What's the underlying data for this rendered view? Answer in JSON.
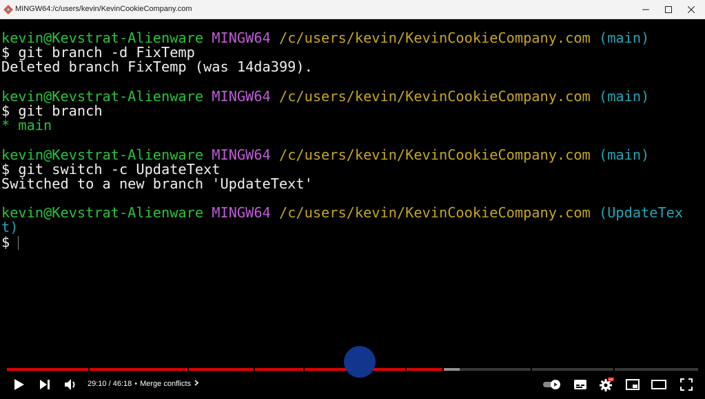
{
  "window": {
    "title": "MINGW64:/c/users/kevin/KevinCookieCompany.com"
  },
  "terminal": {
    "blocks": [
      {
        "user": "kevin@Kevstrat-Alienware",
        "env": "MINGW64",
        "path": "/c/users/kevin/KevinCookieCompany.com",
        "branch": "(main)",
        "command": "$ git branch -d FixTemp",
        "output": "Deleted branch FixTemp (was 14da399)."
      },
      {
        "user": "kevin@Kevstrat-Alienware",
        "env": "MINGW64",
        "path": "/c/users/kevin/KevinCookieCompany.com",
        "branch": "(main)",
        "command": "$ git branch",
        "output": "* main"
      },
      {
        "user": "kevin@Kevstrat-Alienware",
        "env": "MINGW64",
        "path": "/c/users/kevin/KevinCookieCompany.com",
        "branch": "(main)",
        "command": "$ git switch -c UpdateText",
        "output": "Switched to a new branch 'UpdateText'"
      },
      {
        "user": "kevin@Kevstrat-Alienware",
        "env": "MINGW64",
        "path": "/c/users/kevin/KevinCookieCompany.com",
        "branch_part1": "(UpdateTex",
        "branch_part2": "t)",
        "prompt": "$"
      }
    ]
  },
  "player": {
    "current_time": "29:10",
    "duration": "46:18",
    "separator": "•",
    "chapter": "Merge conflicts",
    "progress_fraction": 0.63,
    "buffer_fraction": 0.655,
    "hd_badge": "HD",
    "accent_color": "#e10000",
    "icons": [
      "play-icon",
      "next-icon",
      "volume-icon",
      "autoplay-toggle-icon",
      "subtitles-icon",
      "settings-icon",
      "miniplayer-icon",
      "theater-mode-icon",
      "fullscreen-icon"
    ]
  }
}
